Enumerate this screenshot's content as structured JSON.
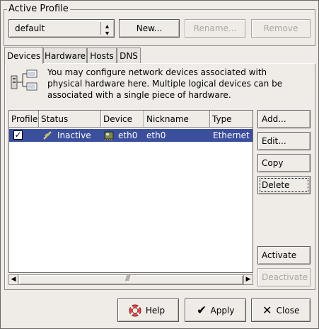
{
  "active_profile": {
    "legend": "Active Profile",
    "selected": "default",
    "new_label": "New...",
    "rename_label": "Rename...",
    "remove_label": "Remove"
  },
  "tabs": [
    {
      "label": "Devices",
      "active": true
    },
    {
      "label": "Hardware",
      "active": false
    },
    {
      "label": "Hosts",
      "active": false
    },
    {
      "label": "DNS",
      "active": false
    }
  ],
  "info_text": "You may configure network devices associated with physical hardware here.  Multiple logical devices can be associated with a single piece of hardware.",
  "table": {
    "columns": [
      "Profile",
      "Status",
      "Device",
      "Nickname",
      "Type"
    ],
    "rows": [
      {
        "profile_checked": true,
        "status": "Inactive",
        "device": "eth0",
        "nickname": "eth0",
        "type": "Ethernet",
        "selected": true
      }
    ]
  },
  "side_buttons": {
    "add": "Add...",
    "edit": "Edit...",
    "copy": "Copy",
    "delete": "Delete",
    "activate": "Activate",
    "deactivate": "Deactivate"
  },
  "footer": {
    "help": "Help",
    "apply": "Apply",
    "close": "Close"
  },
  "colors": {
    "selection": "#3c4f9c",
    "window_bg": "#efebe7"
  }
}
